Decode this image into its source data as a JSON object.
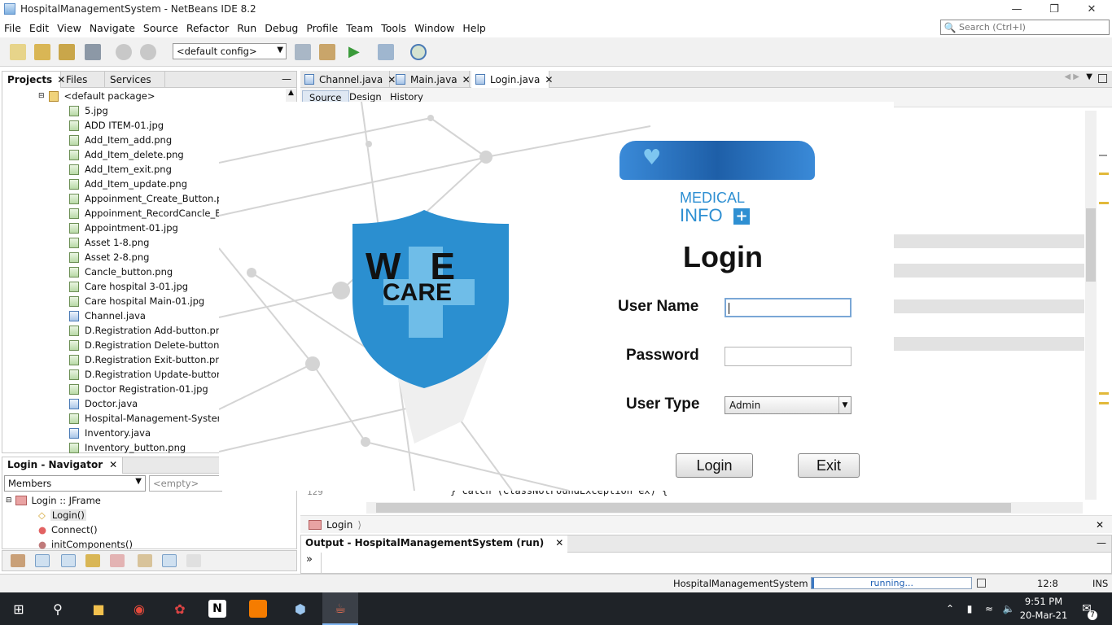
{
  "window": {
    "title": "HospitalManagementSystem - NetBeans IDE 8.2"
  },
  "menu": [
    "File",
    "Edit",
    "View",
    "Navigate",
    "Source",
    "Refactor",
    "Run",
    "Debug",
    "Profile",
    "Team",
    "Tools",
    "Window",
    "Help"
  ],
  "search": {
    "placeholder": "Search (Ctrl+I)"
  },
  "toolbar": {
    "config": "<default config>"
  },
  "projects_panel": {
    "tabs": [
      "Projects",
      "Files",
      "Services"
    ],
    "package": "<default package>",
    "files": [
      "5.jpg",
      "ADD ITEM-01.jpg",
      "Add_Item_add.png",
      "Add_Item_delete.png",
      "Add_Item_exit.png",
      "Add_Item_update.png",
      "Appoinment_Create_Button.png",
      "Appoinment_RecordCancle_Back B",
      "Appointment-01.jpg",
      "Asset 1-8.png",
      "Asset 2-8.png",
      "Cancle_button.png",
      "Care hospital 3-01.jpg",
      "Care hospital Main-01.jpg",
      "Channel.java",
      "D.Registration Add-button.png",
      "D.Registration Delete-button.png",
      "D.Registration Exit-button.png",
      "D.Registration Update-button.png",
      "Doctor Registration-01.jpg",
      "Doctor.java",
      "Hospital-Management-System.png",
      "Inventory.java",
      "Inventory_button.png"
    ]
  },
  "navigator": {
    "title": "Login - Navigator",
    "filter": "Members",
    "filter2": "<empty>",
    "root": "Login :: JFrame",
    "members": [
      "Login()",
      "Connect()",
      "initComponents()"
    ]
  },
  "editor": {
    "tabs": [
      "Channel.java",
      "Main.java",
      "Login.java"
    ],
    "views": [
      "Source",
      "Design",
      "History"
    ],
    "line_number": "129",
    "code_line": "} catch (ClassNotFoundException ex) {",
    "breadcrumb": "Login"
  },
  "output": {
    "title": "Output - HospitalManagementSystem (run)",
    "prompt": "»"
  },
  "status": {
    "project": "HospitalManagementSystem (run)",
    "progress": "running...",
    "position": "12:8",
    "mode": "INS"
  },
  "login": {
    "logo_words": {
      "we": "WE",
      "care": "CARE"
    },
    "medical_text": "MEDICAL",
    "info_text": "INFO",
    "title": "Login",
    "username_label": "User Name",
    "password_label": "Password",
    "usertype_label": "User Type",
    "usertype_value": "Admin",
    "login_button": "Login",
    "exit_button": "Exit"
  },
  "taskbar": {
    "time": "9:51 PM",
    "date": "20-Mar-21",
    "notifications": "7"
  }
}
